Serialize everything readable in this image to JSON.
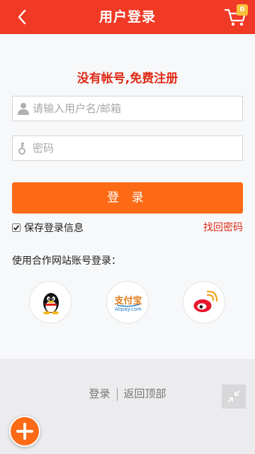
{
  "header": {
    "title": "用户登录",
    "cart_count": "0"
  },
  "form": {
    "register_link": "没有帐号,免费注册",
    "username_placeholder": "请输入用户名/邮箱",
    "password_placeholder": "密码",
    "login_button": "登 录",
    "remember_label": "保存登录信息",
    "remember_checked": true,
    "find_password": "找回密码"
  },
  "partners": {
    "label": "使用合作网站账号登录：",
    "items": [
      "qq",
      "alipay",
      "weibo"
    ],
    "alipay_text": "支付宝",
    "alipay_sub": "Alipay.com"
  },
  "footer": {
    "login_link": "登录",
    "back_to_top": "返回顶部"
  },
  "colors": {
    "brand_red": "#f03a26",
    "accent_orange": "#fc6a16",
    "link_red": "#e02a16",
    "badge_yellow": "#f9c03a"
  }
}
